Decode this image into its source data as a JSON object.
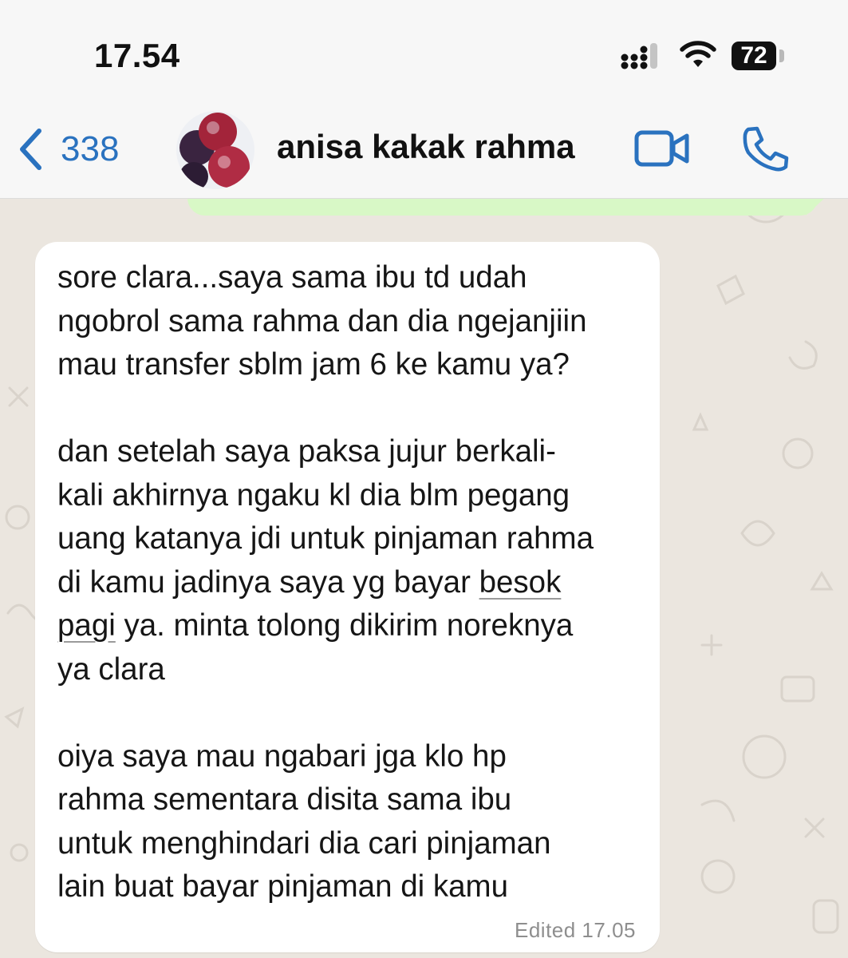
{
  "status_bar": {
    "time": "17.54",
    "battery": "72"
  },
  "header": {
    "back_count": "338",
    "contact_name": "anisa kakak rahma",
    "icons": [
      "back-chevron-icon",
      "avatar",
      "video-call-icon",
      "phone-icon"
    ],
    "accent_color": "#2a72bf"
  },
  "message": {
    "lines": [
      "sore clara...saya sama ibu td udah",
      "ngobrol sama rahma dan dia ngejanjiin",
      "mau transfer sblm jam 6 ke kamu ya?",
      "",
      "dan setelah saya paksa jujur berkali-",
      "kali akhirnya ngaku kl dia blm pegang",
      "uang katanya jdi untuk pinjaman rahma",
      "di kamu jadinya saya yg bayar ",
      "besok",
      "pagi",
      " ya. minta tolong dikirim noreknya",
      "ya clara",
      "",
      "oiya saya mau ngabari jga klo hp",
      "rahma sementara disita sama ibu",
      "untuk menghindari dia cari pinjaman",
      "lain buat bayar pinjaman di kamu"
    ],
    "edited_label": "Edited 17.05",
    "bubble_color": "#ffffff",
    "outgoing_bubble_color": "#d8f8c6",
    "wallpaper_color": "#ebe6df"
  }
}
